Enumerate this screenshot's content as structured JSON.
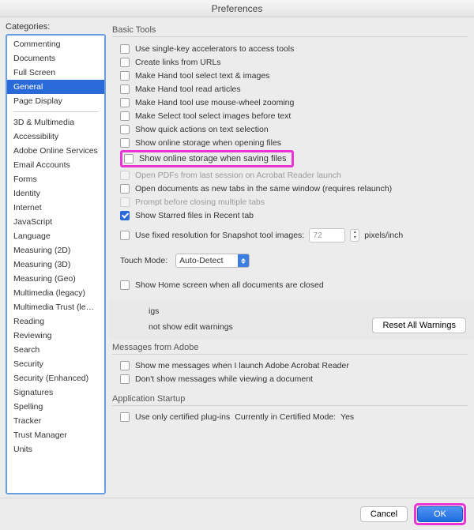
{
  "window": {
    "title": "Preferences"
  },
  "sidebar": {
    "label": "Categories:",
    "group1": [
      {
        "label": "Commenting"
      },
      {
        "label": "Documents"
      },
      {
        "label": "Full Screen"
      },
      {
        "label": "General",
        "selected": true
      },
      {
        "label": "Page Display"
      }
    ],
    "group2": [
      {
        "label": "3D & Multimedia"
      },
      {
        "label": "Accessibility"
      },
      {
        "label": "Adobe Online Services"
      },
      {
        "label": "Email Accounts"
      },
      {
        "label": "Forms"
      },
      {
        "label": "Identity"
      },
      {
        "label": "Internet"
      },
      {
        "label": "JavaScript"
      },
      {
        "label": "Language"
      },
      {
        "label": "Measuring (2D)"
      },
      {
        "label": "Measuring (3D)"
      },
      {
        "label": "Measuring (Geo)"
      },
      {
        "label": "Multimedia (legacy)"
      },
      {
        "label": "Multimedia Trust (legacy)"
      },
      {
        "label": "Reading"
      },
      {
        "label": "Reviewing"
      },
      {
        "label": "Search"
      },
      {
        "label": "Security"
      },
      {
        "label": "Security (Enhanced)"
      },
      {
        "label": "Signatures"
      },
      {
        "label": "Spelling"
      },
      {
        "label": "Tracker"
      },
      {
        "label": "Trust Manager"
      },
      {
        "label": "Units"
      }
    ]
  },
  "panel": {
    "basicTools": {
      "title": "Basic Tools",
      "opts": {
        "singleKey": "Use single-key accelerators to access tools",
        "createLinks": "Create links from URLs",
        "handSelectText": "Make Hand tool select text & images",
        "handReadArticles": "Make Hand tool read articles",
        "handMouseWheel": "Make Hand tool use mouse-wheel zooming",
        "selectImagesBefore": "Make Select tool select images before text",
        "quickActions": "Show quick actions on text selection",
        "onlineOpen": "Show online storage when opening files",
        "onlineSave": "Show online storage when saving files",
        "openLastSession": "Open PDFs from last session on Acrobat Reader launch",
        "openAsTabs": "Open documents as new tabs in the same window (requires relaunch)",
        "promptBeforeClose": "Prompt before closing multiple tabs",
        "showStarred": "Show Starred files in Recent tab"
      },
      "snapshot": {
        "label": "Use fixed resolution for Snapshot tool images:",
        "value": "72",
        "unit": "pixels/inch"
      },
      "touchMode": {
        "label": "Touch Mode:",
        "selected": "Auto-Detect"
      },
      "showHome": "Show Home screen when all documents are closed"
    },
    "warnings": {
      "line1": "igs",
      "line2": "not show edit warnings",
      "reset": "Reset All Warnings"
    },
    "messages": {
      "title": "Messages from Adobe",
      "launch": "Show me messages when I launch Adobe Acrobat Reader",
      "viewing": "Don't show messages while viewing a document"
    },
    "startup": {
      "title": "Application Startup",
      "certified": "Use only certified plug-ins",
      "modeLabel": "Currently in Certified Mode:",
      "modeValue": "Yes"
    }
  },
  "footer": {
    "cancel": "Cancel",
    "ok": "OK"
  }
}
